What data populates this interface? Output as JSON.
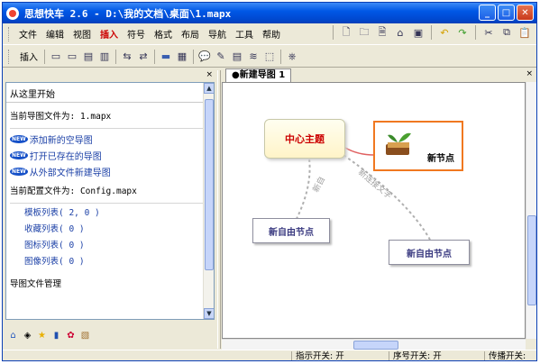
{
  "window": {
    "title": "思想快车 2.6 - D:\\我的文档\\桌面\\1.mapx",
    "min": "_",
    "max": "□",
    "close": "✕"
  },
  "menubar": {
    "items": [
      "文件",
      "编辑",
      "视图",
      "插入",
      "符号",
      "格式",
      "布局",
      "导航",
      "工具",
      "帮助"
    ],
    "active_index": 3
  },
  "toolbar2": {
    "insert_label": "插入"
  },
  "leftpanel": {
    "close": "×",
    "title": "从这里开始",
    "current_map_label": "当前导图文件为: 1.mapx",
    "links": [
      "添加新的空导图",
      "打开已存在的导图",
      "从外部文件新建导图"
    ],
    "link_badge": "NEW",
    "current_config_label": "当前配置文件为: Config.mapx",
    "lists": [
      "模板列表( 2, 0 )",
      "收藏列表( 0 )",
      "图标列表( 0 )",
      "图像列表( 0 )"
    ],
    "manage_label": "导图文件管理",
    "bottom_icons": [
      "home-icon",
      "tag-icon",
      "star-icon",
      "book-icon",
      "palette-icon",
      "image-icon"
    ]
  },
  "tabs": {
    "active": "●新建导图 1",
    "close": "×"
  },
  "canvas": {
    "center": "中心主题",
    "new_node": "新节点",
    "free1": "新自由节点",
    "free2": "新自由节点",
    "connector1": "新自",
    "connector2": "新连接文字"
  },
  "status": {
    "indicator": "指示开关: 开",
    "sequence": "序号开关: 开",
    "broadcast": "传播开关:"
  },
  "colors": {
    "accent": "#0058e6",
    "active_menu": "#c00000",
    "node_border": "#f07820"
  }
}
